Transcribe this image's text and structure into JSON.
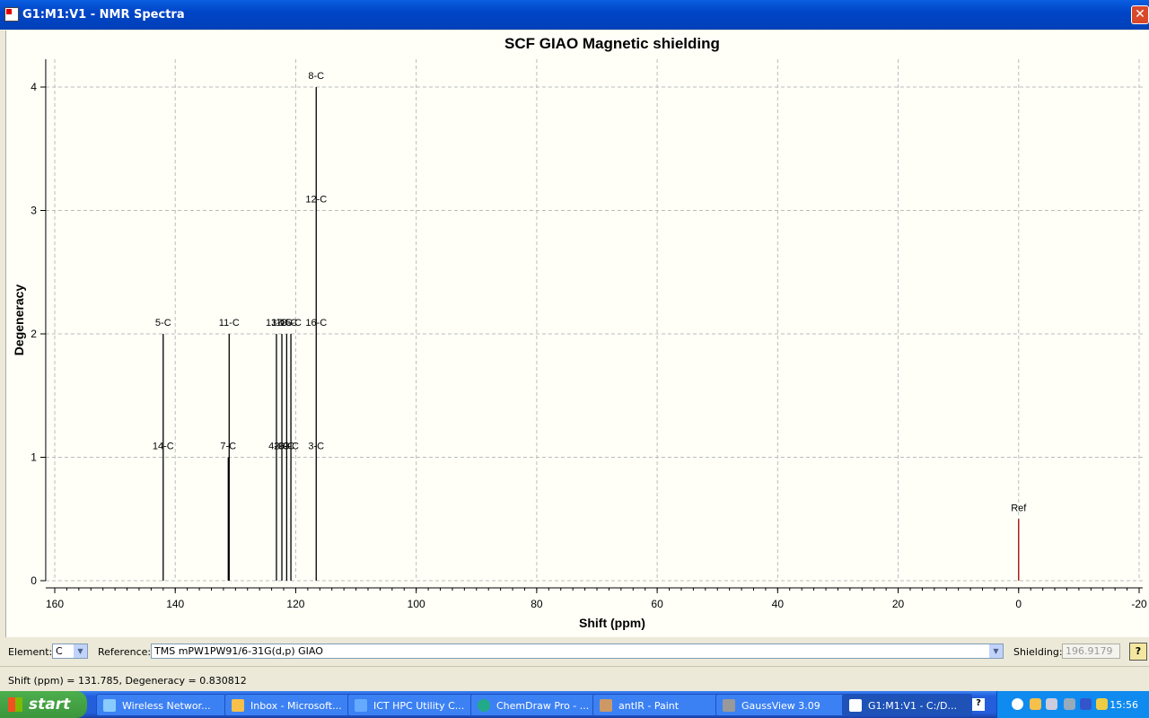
{
  "window": {
    "title": "G1:M1:V1 - NMR Spectra",
    "close": "✕"
  },
  "chart_data": {
    "type": "bar",
    "title": "SCF GIAO Magnetic shielding",
    "xlabel": "Shift (ppm)",
    "ylabel": "Degeneracy",
    "xlim": [
      160,
      -20
    ],
    "ylim": [
      0,
      4.2
    ],
    "xticks": [
      160,
      140,
      120,
      100,
      80,
      60,
      40,
      20,
      0,
      -20
    ],
    "yticks": [
      0,
      1,
      2,
      3,
      4
    ],
    "grid": true,
    "peaks": [
      {
        "shift": 142.0,
        "degeneracy": 2,
        "labels": [
          "14-C",
          "5-C"
        ]
      },
      {
        "shift": 131.2,
        "degeneracy": 1,
        "labels": [
          "7-C"
        ]
      },
      {
        "shift": 131.05,
        "degeneracy": 2,
        "labels": [
          "",
          "11-C"
        ]
      },
      {
        "shift": 123.2,
        "degeneracy": 2,
        "labels": [
          "4-C",
          "13-C"
        ]
      },
      {
        "shift": 122.3,
        "degeneracy": 2,
        "labels": [
          "2-C",
          "17-C"
        ]
      },
      {
        "shift": 121.5,
        "degeneracy": 2,
        "labels": [
          "6-C",
          "18-C"
        ]
      },
      {
        "shift": 120.8,
        "degeneracy": 2,
        "labels": [
          "9-C",
          "15-C"
        ]
      },
      {
        "shift": 116.6,
        "degeneracy": 4,
        "labels": [
          "3-C",
          "16-C",
          "12-C",
          "8-C"
        ]
      }
    ],
    "reference": {
      "shift": 0,
      "degeneracy": 0.5,
      "label": "Ref",
      "color": "#a00000"
    }
  },
  "controls": {
    "element_label": "Element:",
    "element_value": "C",
    "reference_label": "Reference:",
    "reference_value": "TMS mPW1PW91/6-31G(d,p) GIAO",
    "shielding_label": "Shielding:",
    "shielding_value": "196.9179",
    "help": "?"
  },
  "status": "Shift (ppm) = 131.785,  Degeneracy = 0.830812",
  "taskbar": {
    "start": "start",
    "tasks": [
      "Wireless Networ...",
      "Inbox - Microsoft...",
      "ICT HPC Utility C...",
      "ChemDraw Pro - ...",
      "antIR - Paint",
      "GaussView 3.09",
      "G1:M1:V1 - C:/D..."
    ],
    "clock": "15:56",
    "help": "?"
  }
}
